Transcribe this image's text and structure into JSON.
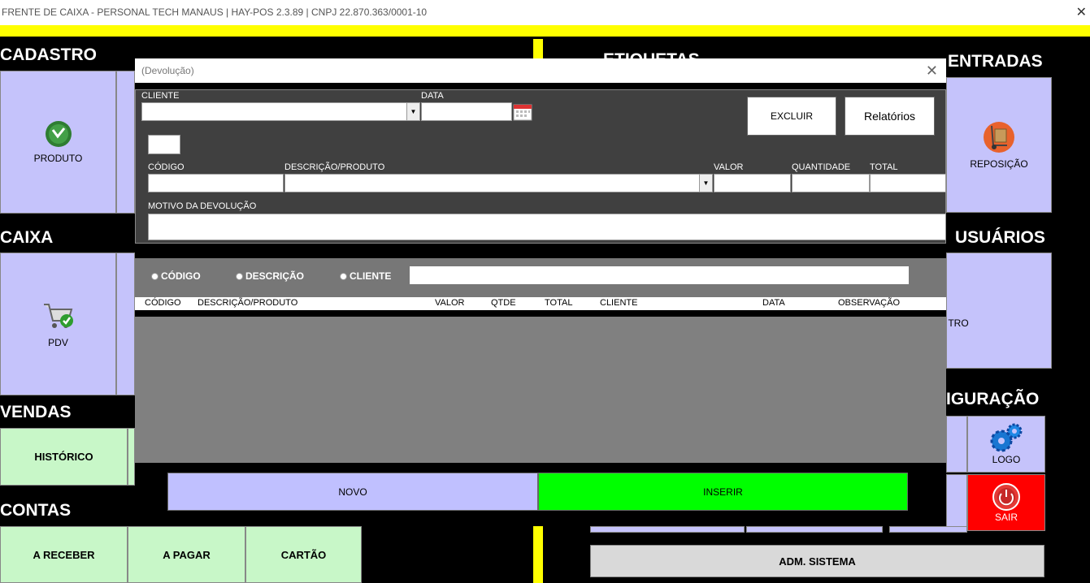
{
  "window": {
    "title": "FRENTE DE CAIXA - PERSONAL TECH MANAUS | HAY-POS 2.3.89 | CNPJ 22.870.363/0001-10",
    "close": "✕"
  },
  "sections": {
    "cadastro": "CADASTRO",
    "caixa": "CAIXA",
    "vendas": "VENDAS",
    "contas": "CONTAS",
    "etiquetas": "ETIQUETAS",
    "entradas": "ENTRADAS",
    "usuarios": "USUÁRIOS",
    "configuracao": "IGURAÇÃO"
  },
  "tiles": {
    "produto": "PRODUTO",
    "pdv": "PDV",
    "historico": "HISTÓRICO",
    "a_receber": "A RECEBER",
    "a_pagar": "A PAGAR",
    "cartao": "CARTÃO",
    "reposicao": "REPOSIÇÃO",
    "cadastro_usuario": "TRO",
    "logo": "LOGO",
    "sair": "SAIR",
    "adm_sistema": "ADM. SISTEMA"
  },
  "dialog": {
    "title": "(Devolução)",
    "close": "✕",
    "labels": {
      "cliente": "CLIENTE",
      "data": "DATA",
      "codigo": "CÓDIGO",
      "descricao": "DESCRIÇÃO/PRODUTO",
      "valor": "VALOR",
      "quantidade": "QUANTIDADE",
      "total": "TOTAL",
      "motivo": "MOTIVO DA DEVOLUÇÃO"
    },
    "buttons": {
      "excluir": "EXCLUIR",
      "relatorios": "Relatórios",
      "novo": "NOVO",
      "inserir": "INSERIR"
    },
    "search": {
      "radio_codigo": "CÓDIGO",
      "radio_descricao": "DESCRIÇÃO",
      "radio_cliente": "CLIENTE"
    },
    "grid_columns": [
      "CÓDIGO",
      "DESCRIÇÃO/PRODUTO",
      "VALOR",
      "QTDE",
      "TOTAL",
      "CLIENTE",
      "DATA",
      "OBSERVAÇÃO"
    ]
  }
}
